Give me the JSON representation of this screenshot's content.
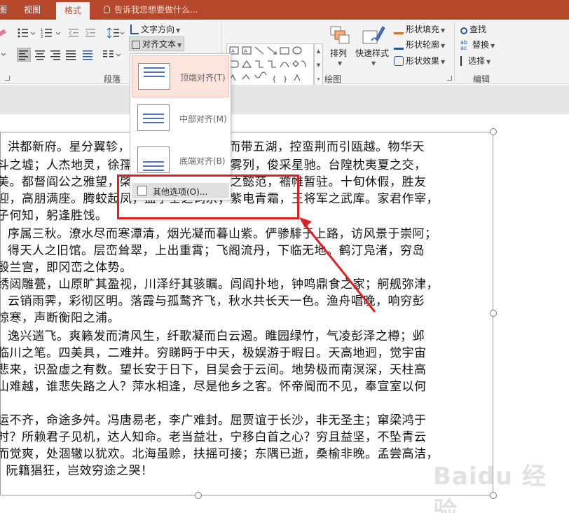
{
  "tabs": {
    "partial_left": "图",
    "view": "视图",
    "format": "格式",
    "tell_me": "告诉我您想要做什么..."
  },
  "ribbon": {
    "text_direction": "文字方向",
    "align_text": "对齐文本",
    "paragraph_group": "段落",
    "arrange": "排列",
    "quick_styles": "快速样式",
    "shape_fill": "形状填充",
    "shape_outline": "形状轮廓",
    "shape_effects": "形状效果",
    "drawing_group": "绘图",
    "find": "查找",
    "replace": "替换",
    "select": "选择",
    "editing_group": "编辑"
  },
  "dropdown": {
    "items": [
      {
        "label": "顶端对齐(T)"
      },
      {
        "label": "中部对齐(M)"
      },
      {
        "label": "底端对齐(B)"
      }
    ],
    "more_options": "其他选项(O)..."
  },
  "document": {
    "lines": [
      "洪都新府。星分翼轸，地接衡庐。襟三江而带五湖，控蛮荆而引瓯越。物华天",
      "斗之墟；人杰地灵，徐孺下陈蕃之榻。雄州雾列，俊采星驰。台隍枕夷夏之交，",
      "美。都督阎公之雅望，棨戟遥临；宇文新州之懿范，襜帷暂驻。十旬休假，胜友",
      "迎，高朋满座。腾蛟起凤，孟学士之词宗；紫电青霜，王将军之武库。家君作宰，",
      "子何知，躬逢胜饯。",
      "序属三秋。潦水尽而寒潭清，烟光凝而暮山紫。俨骖騑于上路，访风景于崇阿；",
      "得天人之旧馆。层峦耸翠，上出重霄；飞阁流丹，下临无地。鹤汀凫渚，穷岛",
      "殷兰宫，即冈峦之体势。",
      "绣闼雕甍，山原旷其盈视，川泽纡其骇瞩。闾阎扑地，钟鸣鼎食之家；舸舰弥津，",
      "云销雨霁，彩彻区明。落霞与孤鹜齐飞，秋水共长天一色。渔舟唱晚，响穷彭",
      "惊寒，声断衡阳之浦。",
      "逸兴遄飞。爽籁发而清风生，纤歌凝而白云遏。睢园绿竹，气凌彭泽之樽；邺",
      "临川之笔。四美具，二难并。穷睇眄于中天，极娱游于暇日。天高地迥，觉宇宙",
      "悲来，识盈虚之有数。望长安于日下，目吴会于云间。地势极而南溟深，天柱高",
      "山难越，谁悲失路之人？萍水相逢，尽是他乡之客。怀帝阍而不见，奉宣室以何",
      "",
      "运不齐，命途多舛。冯唐易老，李广难封。屈贾谊于长沙，非无圣主；窜梁鸿于",
      "时？所赖君子见机，达人知命。老当益壮，宁移白首之心？穷且益坚，不坠青云",
      "而觉爽，处涸辙以犹欢。北海虽赊，扶摇可接；东隅已逝，桑榆非晚。孟尝高洁，",
      "；阮籍猖狂，岂效穷途之哭！"
    ]
  },
  "watermark": "Baidu 经验",
  "colors": {
    "accent": "#b7472a",
    "highlight": "#e02020"
  }
}
